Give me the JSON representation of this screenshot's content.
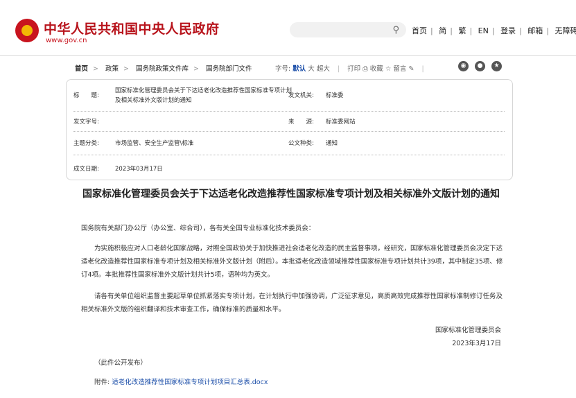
{
  "header": {
    "site_title": "中华人民共和国中央人民政府",
    "site_domain": "www.gov.cn",
    "search_icon": "search-icon",
    "nav": [
      "首页",
      "简",
      "繁",
      "EN",
      "登录",
      "邮箱",
      "无障碍"
    ]
  },
  "breadcrumb": [
    "首页",
    "政策",
    "国务院政策文件库",
    "国务院部门文件"
  ],
  "tools": {
    "font_label": "字号:",
    "font_default": "默认",
    "font_large": "大",
    "font_xlarge": "超大",
    "print": "打印",
    "favorite": "收藏",
    "comment": "留言"
  },
  "meta": {
    "title_label": "标　　题:",
    "title_value": "国家标准化管理委员会关于下达适老化改造推荐性国家标准专项计划及相关标准外文版计划的通知",
    "issuer_label": "发文机关:",
    "issuer_value": "标准委",
    "doc_no_label": "发文字号:",
    "doc_no_value": "",
    "source_label": "来　　源:",
    "source_value": "标准委网站",
    "topic_label": "主题分类:",
    "topic_value": "市场监管、安全生产监管\\标准",
    "type_label": "公文种类:",
    "type_value": "通知",
    "date_label": "成文日期:",
    "date_value": "2023年03月17日"
  },
  "document": {
    "title": "国家标准化管理委员会关于下达适老化改造推荐性国家标准专项计划及相关标准外文版计划的通知",
    "salutation": "国务院有关部门办公厅（办公室、综合司），各有关全国专业标准化技术委员会：",
    "para1": "为实施积极应对人口老龄化国家战略，对照全国政协关于加快推进社会适老化改造的民主监督事项，经研究，国家标准化管理委员会决定下达适老化改造推荐性国家标准专项计划及相关标准外文版计划（附后）。本批适老化改造领域推荐性国家标准专项计划共计39项，其中制定35项、修订4项。本批推荐性国家标准外文版计划共计5项，语种均为英文。",
    "para2": "请各有关单位组织监督主要起草单位抓紧落实专项计划，在计划执行中加强协调，广泛征求意见，高质高效完成推荐性国家标准制修订任务及相关标准外文版的组织翻译和技术审查工作，确保标准的质量和水平。",
    "signer": "国家标准化管理委员会",
    "sign_date": "2023年3月17日",
    "public_note": "（此件公开发布）",
    "attachment_label": "附件:",
    "attachment_link": "适老化改造推荐性国家标准专项计划项目汇总表.docx"
  }
}
